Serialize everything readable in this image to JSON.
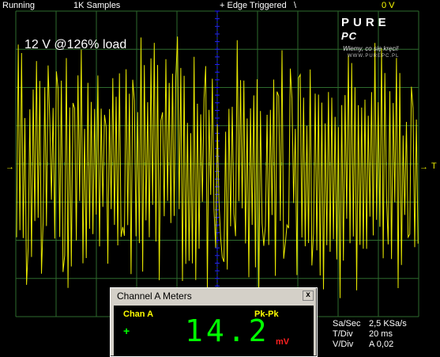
{
  "topbar": {
    "status": "Running",
    "samples": "1K Samples",
    "trigger": "+ Edge Triggered",
    "trigger_slope": "\\",
    "trigger_level": "0 V"
  },
  "caption": "12 V @126% load",
  "trigger_marker": "T",
  "logo": {
    "line1": "PURE",
    "line2": "PC",
    "line3": "Wiemy, co się kręci!",
    "line4": "WWW.PUREPC.PL"
  },
  "meters": {
    "title": "Channel A Meters",
    "close_label": "x",
    "channel": "Chan A",
    "coupling": "+",
    "measure": "Pk-Pk",
    "value": "14.2",
    "unit": "mV"
  },
  "info": {
    "rows": [
      {
        "key": "Sa/Sec",
        "value": "2,5 KSa/s"
      },
      {
        "key": "T/Div",
        "value": "20 ms"
      },
      {
        "key": "V/Div",
        "value": "A 0,02"
      }
    ]
  },
  "colors": {
    "trace": "#e8e800",
    "grid": "#2e6b2e",
    "cursor": "#2020ff",
    "meter_digits": "#00ff00"
  }
}
